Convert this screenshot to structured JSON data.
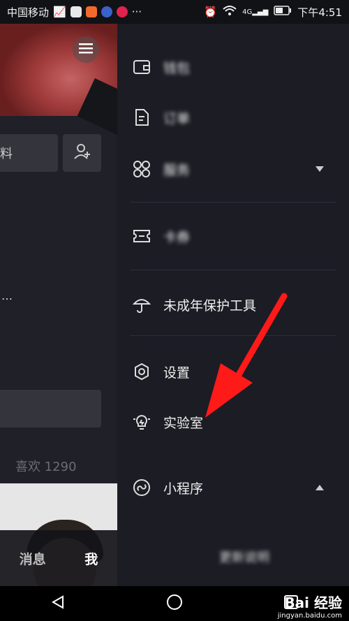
{
  "status_bar": {
    "carrier": "中国移动",
    "time": "下午4:51",
    "signal_label": "4G",
    "app_colors": [
      "#e8e8e8",
      "#f16a2c",
      "#3a62c8",
      "#e0234e"
    ]
  },
  "left_panel": {
    "profile_snippet": "料",
    "dots": "…",
    "likes": "喜欢 1290",
    "tabs": [
      "消息",
      "我"
    ]
  },
  "drawer": {
    "items": [
      {
        "label": "钱包",
        "icon": "wallet-icon",
        "blurred": true
      },
      {
        "label": "订单",
        "icon": "order-icon",
        "blurred": true
      },
      {
        "label": "服务",
        "icon": "services-icon",
        "blurred": true,
        "caret": "down"
      },
      {
        "label": "卡券",
        "icon": "coupon-icon",
        "blurred": true
      },
      {
        "label": "未成年保护工具",
        "icon": "umbrella-icon",
        "blurred": false
      },
      {
        "label": "设置",
        "icon": "gear-icon",
        "blurred": false
      },
      {
        "label": "实验室",
        "icon": "lightbulb-icon",
        "blurred": false
      },
      {
        "label": "小程序",
        "icon": "mini-program-icon",
        "blurred": false,
        "caret": "up"
      }
    ],
    "footer_text": "更新说明"
  },
  "watermark": {
    "brand": "Bai 经验",
    "url": "jingyan.baidu.com"
  },
  "colors": {
    "arrow": "#ff1a1a",
    "drawer_bg": "#1b1c24",
    "accent_text": "#f0f0f0"
  }
}
